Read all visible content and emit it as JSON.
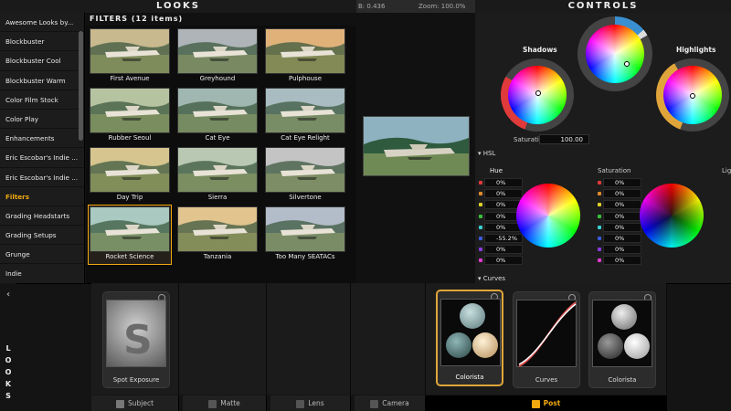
{
  "header": {
    "looks_title": "LOOKS",
    "controls_title": "CONTROLS"
  },
  "status": {
    "left": "B: 0.436",
    "zoom": "Zoom: 100.0%"
  },
  "sidebar": {
    "items": [
      {
        "label": "Awesome Looks by..."
      },
      {
        "label": "Blockbuster"
      },
      {
        "label": "Blockbuster Cool"
      },
      {
        "label": "Blockbuster Warm"
      },
      {
        "label": "Color Film Stock"
      },
      {
        "label": "Color Play"
      },
      {
        "label": "Enhancements"
      },
      {
        "label": "Eric Escobar's Indie ..."
      },
      {
        "label": "Eric Escobar's Indie ..."
      },
      {
        "label": "Filters"
      },
      {
        "label": "Grading Headstarts"
      },
      {
        "label": "Grading Setups"
      },
      {
        "label": "Grunge"
      },
      {
        "label": "Indie"
      }
    ],
    "active_index": 9
  },
  "filters": {
    "title": "FILTERS (12 items)",
    "items": [
      {
        "label": "First Avenue",
        "tint": "#c9b98f"
      },
      {
        "label": "Greyhound",
        "tint": "#aeb4b8"
      },
      {
        "label": "Pulphouse",
        "tint": "#e0b27a"
      },
      {
        "label": "Rubber Seoul",
        "tint": "#b6c3a0"
      },
      {
        "label": "Cat Eye",
        "tint": "#9fb7b0"
      },
      {
        "label": "Cat Eye Relight",
        "tint": "#a8bcc2"
      },
      {
        "label": "Day Trip",
        "tint": "#d6c58e"
      },
      {
        "label": "Sierra",
        "tint": "#b9c8b2"
      },
      {
        "label": "Silvertone",
        "tint": "#c4c4c4"
      },
      {
        "label": "Rocket Science",
        "tint": "#a9c9c1"
      },
      {
        "label": "Tanzania",
        "tint": "#e1c48e"
      },
      {
        "label": "Too Many SEATACs",
        "tint": "#b3bcc9"
      }
    ],
    "selected_index": 9
  },
  "controls": {
    "shadows_label": "Shadows",
    "highlights_label": "Highlights",
    "saturation_label": "Saturation:",
    "saturation_value": "100.00",
    "hsl_label": "HSL",
    "hue_label": "Hue",
    "sat_col_label": "Saturation",
    "lig_col_label": "Lig",
    "hue_values": [
      "0%",
      "0%",
      "0%",
      "0%",
      "0%",
      "-55.2%",
      "0%",
      "0%"
    ],
    "sat_values": [
      "0%",
      "0%",
      "0%",
      "0%",
      "0%",
      "0%",
      "0%",
      "0%"
    ],
    "curves_label": "Curves",
    "accent_orange": "#e0a53a",
    "accent_blue": "#3a8fd0"
  },
  "bottom": {
    "vertical_label": [
      "L",
      "O",
      "O",
      "K",
      "S"
    ],
    "cards": [
      {
        "label": "Spot Exposure"
      },
      {
        "label": "Colorista"
      },
      {
        "label": "Curves"
      },
      {
        "label": "Colorista"
      }
    ],
    "tabs": [
      {
        "label": "Subject"
      },
      {
        "label": "Matte"
      },
      {
        "label": "Lens"
      },
      {
        "label": "Camera"
      },
      {
        "label": "Post"
      }
    ],
    "active_tab_index": 4
  }
}
